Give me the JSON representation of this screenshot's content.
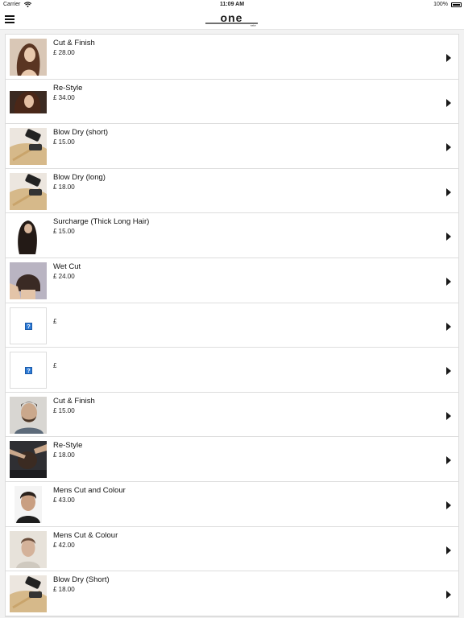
{
  "status_bar": {
    "carrier": "Carrier",
    "time": "11:09 AM",
    "battery": "100%"
  },
  "nav": {
    "menu_icon": "hamburger-menu-icon",
    "logo_text": "one",
    "logo_subtext": "salon"
  },
  "services": [
    {
      "name": "Cut & Finish",
      "price": "£ 28.00",
      "image": "woman-long-wavy-hair"
    },
    {
      "name": "Re-Style",
      "price": "£ 34.00",
      "image": "woman-styled-hair"
    },
    {
      "name": "Blow Dry (short)",
      "price": "£ 15.00",
      "image": "blow-dryer-brush"
    },
    {
      "name": "Blow Dry (long)",
      "price": "£ 18.00",
      "image": "blow-dryer-brush"
    },
    {
      "name": "Surcharge (Thick Long Hair)",
      "price": "£ 15.00",
      "image": "long-dark-hair"
    },
    {
      "name": "Wet Cut",
      "price": "£ 24.00",
      "image": "bob-haircut"
    },
    {
      "name": "",
      "price": "£",
      "image": "missing-image"
    },
    {
      "name": "",
      "price": "£",
      "image": "missing-image"
    },
    {
      "name": "Cut & Finish",
      "price": "£ 15.00",
      "image": "man-beard-haircut"
    },
    {
      "name": "Re-Style",
      "price": "£ 18.00",
      "image": "barber-cutting"
    },
    {
      "name": "Mens Cut and Colour",
      "price": "£ 43.00",
      "image": "man-portrait"
    },
    {
      "name": "Mens Cut & Colour",
      "price": "£ 42.00",
      "image": "man-portrait-light"
    },
    {
      "name": "Blow Dry (Short)",
      "price": "£ 18.00",
      "image": "blow-dryer-brush"
    }
  ],
  "colors": {
    "background": "#f2f2f2",
    "row_bg": "#ffffff",
    "divider": "#dddddd",
    "text": "#111111"
  }
}
